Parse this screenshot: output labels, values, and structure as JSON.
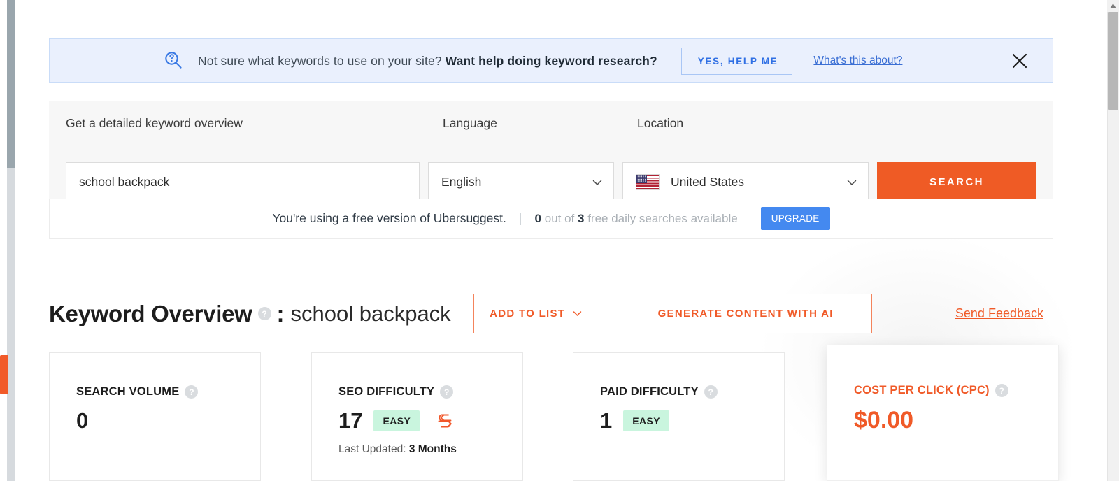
{
  "banner": {
    "icon": "search-question-icon",
    "text_normal": "Not sure what keywords to use on your site? ",
    "text_bold": "Want help doing keyword research?",
    "cta_label": "YES, HELP ME",
    "link_label": "What's this about?",
    "close_icon": "close-icon",
    "bg_color": "#eaf0fd",
    "accent_color": "#3b6fd4"
  },
  "search_panel": {
    "keyword_label": "Get a detailed keyword overview",
    "keyword_value": "school backpack",
    "keyword_placeholder": "Enter a keyword",
    "language_label": "Language",
    "language_value": "English",
    "location_label": "Location",
    "location_value": "United States",
    "location_flag": "us-flag-icon",
    "search_button": "SEARCH",
    "search_button_color": "#ef5b25"
  },
  "free_bar": {
    "message": "You're using a free version of Ubersuggest.",
    "separator": "|",
    "used_count": "0",
    "mid_text": " out of ",
    "total_count": "3",
    "tail_text": " free daily searches available",
    "upgrade_label": "UPGRADE",
    "upgrade_color": "#4489f0"
  },
  "overview": {
    "title": "Keyword Overview",
    "help_icon": "help-icon",
    "colon": ":",
    "keyword": "school backpack",
    "add_to_list_label": "ADD TO LIST",
    "add_to_list_chevron": "chevron-down-icon",
    "generate_ai_label": "GENERATE CONTENT WITH AI",
    "feedback_label": "Send Feedback",
    "accent_color": "#f05a28"
  },
  "cards": [
    {
      "label": "SEARCH VOLUME",
      "help_icon": "help-icon",
      "value": "0",
      "badge": null,
      "refresh_icon": null,
      "sub_prefix": null,
      "sub_value": null,
      "highlight": false
    },
    {
      "label": "SEO DIFFICULTY",
      "help_icon": "help-icon",
      "value": "17",
      "badge": "EASY",
      "refresh_icon": "refresh-icon",
      "sub_prefix": "Last Updated: ",
      "sub_value": "3 Months",
      "highlight": false
    },
    {
      "label": "PAID DIFFICULTY",
      "help_icon": "help-icon",
      "value": "1",
      "badge": "EASY",
      "refresh_icon": null,
      "sub_prefix": null,
      "sub_value": null,
      "highlight": false
    },
    {
      "label": "COST PER CLICK (CPC)",
      "help_icon": "help-icon",
      "value": "$0.00",
      "badge": null,
      "refresh_icon": null,
      "sub_prefix": null,
      "sub_value": null,
      "highlight": true
    }
  ],
  "chrome": {
    "left_tab": "feedback-side-tab",
    "right_scrollbar": "vertical-scrollbar"
  }
}
